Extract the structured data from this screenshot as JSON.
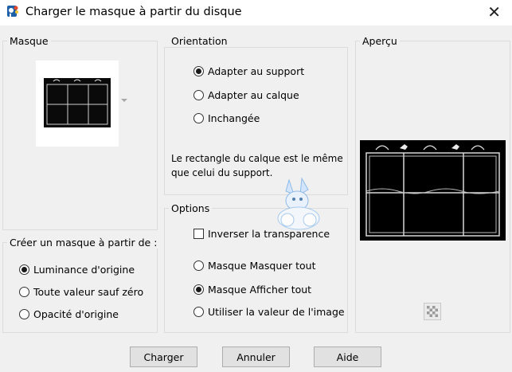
{
  "window": {
    "title": "Charger le masque à partir du disque",
    "close_glyph": "✕"
  },
  "groups": {
    "masque": "Masque",
    "orientation": "Orientation",
    "apercu": "Aperçu",
    "options": "Options",
    "creer": "Créer un masque à partir de :"
  },
  "orientation": {
    "items": [
      {
        "label": "Adapter au support",
        "checked": true
      },
      {
        "label": "Adapter au calque",
        "checked": false
      },
      {
        "label": "Inchangée",
        "checked": false
      }
    ],
    "description": "Le rectangle du calque est le même que celui du support."
  },
  "options": {
    "invert_label": "Inverser la transparence",
    "invert_checked": false,
    "items": [
      {
        "label": "Masque Masquer tout",
        "checked": false
      },
      {
        "label": "Masque Afficher tout",
        "checked": true
      },
      {
        "label": "Utiliser la valeur de l'image",
        "checked": false
      }
    ]
  },
  "source": {
    "items": [
      {
        "label": "Luminance d'origine",
        "checked": true
      },
      {
        "label": "Toute valeur sauf zéro",
        "checked": false
      },
      {
        "label": "Opacité d'origine",
        "checked": false
      }
    ]
  },
  "buttons": {
    "load": "Charger",
    "cancel": "Annuler",
    "help": "Aide"
  },
  "icons": {
    "app": "paint-shop-pro-icon",
    "close": "close-icon",
    "dropdown": "chevron-down-icon",
    "checker": "transparency-checkerboard-icon"
  },
  "colors": {
    "window_bg": "#f0f0f0",
    "titlebar_bg": "#ffffff",
    "button_bg": "#e1e1e1",
    "preview_bg": "#000000"
  }
}
